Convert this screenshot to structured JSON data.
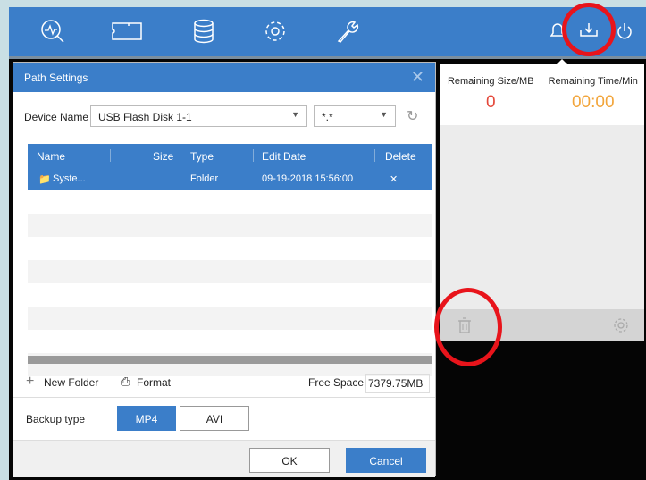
{
  "topbar": {
    "icons": [
      "live-view-icon",
      "playback-icon",
      "storage-icon",
      "settings-gear-icon",
      "maintenance-wrench-icon",
      "alarm-bell-icon",
      "download-icon",
      "power-icon"
    ]
  },
  "right_panel": {
    "col1_header": "Remaining Size/MB",
    "col1_value": "0",
    "col2_header": "Remaining Time/Min",
    "col2_value": "00:00"
  },
  "dialog": {
    "title": "Path Settings",
    "device_label": "Device Name",
    "device_value": "USB Flash Disk 1-1",
    "filter_value": "*.*",
    "columns": [
      "Name",
      "Size",
      "Type",
      "Edit Date",
      "Delete"
    ],
    "rows": [
      {
        "name": "Syste...",
        "size": "",
        "type": "Folder",
        "date": "09-19-2018 15:56:00",
        "delete": "✕"
      }
    ],
    "new_folder": "New Folder",
    "format": "Format",
    "free_space_label": "Free Space",
    "free_space_value": "7379.75MB",
    "backup_type_label": "Backup type",
    "backup_options": [
      "MP4",
      "AVI"
    ],
    "ok": "OK",
    "cancel": "Cancel"
  },
  "colors": {
    "accent": "#3b7ec9",
    "highlight_circle": "#e8141b",
    "remaining_size": "#e4483a",
    "remaining_time": "#f2a53b"
  }
}
